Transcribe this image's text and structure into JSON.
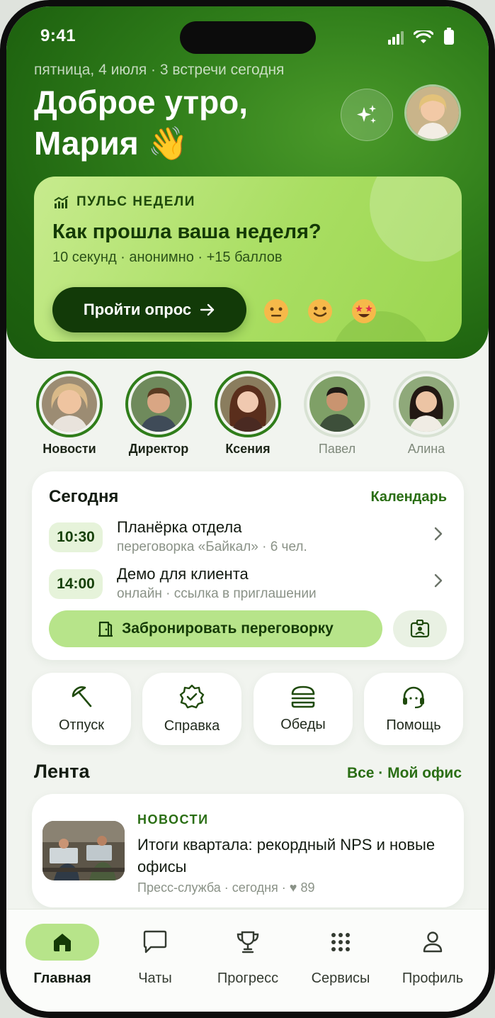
{
  "status": {
    "time": "9:41"
  },
  "header": {
    "date_line": "пятница, 4 июля · 3 встречи сегодня",
    "greeting_line1": "Доброе утро,",
    "greeting_line2": "Мария 👋"
  },
  "pulse": {
    "tag": "ПУЛЬС НЕДЕЛИ",
    "title": "Как прошла ваша неделя?",
    "subtitle": "10 секунд · анонимно · +15 баллов",
    "button_label": "Пройти опрос"
  },
  "stories": [
    {
      "name": "Новости",
      "state": "active"
    },
    {
      "name": "Директор",
      "state": "active"
    },
    {
      "name": "Ксения",
      "state": "active"
    },
    {
      "name": "Павел",
      "state": "seen"
    },
    {
      "name": "Алина",
      "state": "seen"
    }
  ],
  "today": {
    "title": "Сегодня",
    "calendar_link": "Календарь",
    "meetings": [
      {
        "time": "10:30",
        "title": "Планёрка отдела",
        "sub": "переговорка «Байкал» · 6 чел."
      },
      {
        "time": "14:00",
        "title": "Демо для клиента",
        "sub": "онлайн · ссылка в приглашении"
      }
    ],
    "book_label": "Забронировать переговорку"
  },
  "quick_actions": [
    {
      "label": "Отпуск",
      "icon": "umbrella-icon"
    },
    {
      "label": "Справка",
      "icon": "verified-badge-icon"
    },
    {
      "label": "Обеды",
      "icon": "burger-icon"
    },
    {
      "label": "Помощь",
      "icon": "headset-icon"
    }
  ],
  "feed": {
    "title": "Лента",
    "link": "Все · Мой офис",
    "item": {
      "category": "НОВОСТИ",
      "title": "Итоги квартала: рекордный NPS и новые офисы",
      "meta": "Пресс-служба · сегодня · ♥ 89"
    }
  },
  "tabs": [
    {
      "label": "Главная",
      "icon": "home-icon",
      "active": true
    },
    {
      "label": "Чаты",
      "icon": "chat-icon",
      "active": false
    },
    {
      "label": "Прогресс",
      "icon": "trophy-icon",
      "active": false
    },
    {
      "label": "Сервисы",
      "icon": "grid-icon",
      "active": false
    },
    {
      "label": "Профиль",
      "icon": "user-icon",
      "active": false
    }
  ],
  "colors": {
    "brand_dark": "#1f6410",
    "accent_light": "#b7e48a",
    "link": "#2a6e14"
  }
}
